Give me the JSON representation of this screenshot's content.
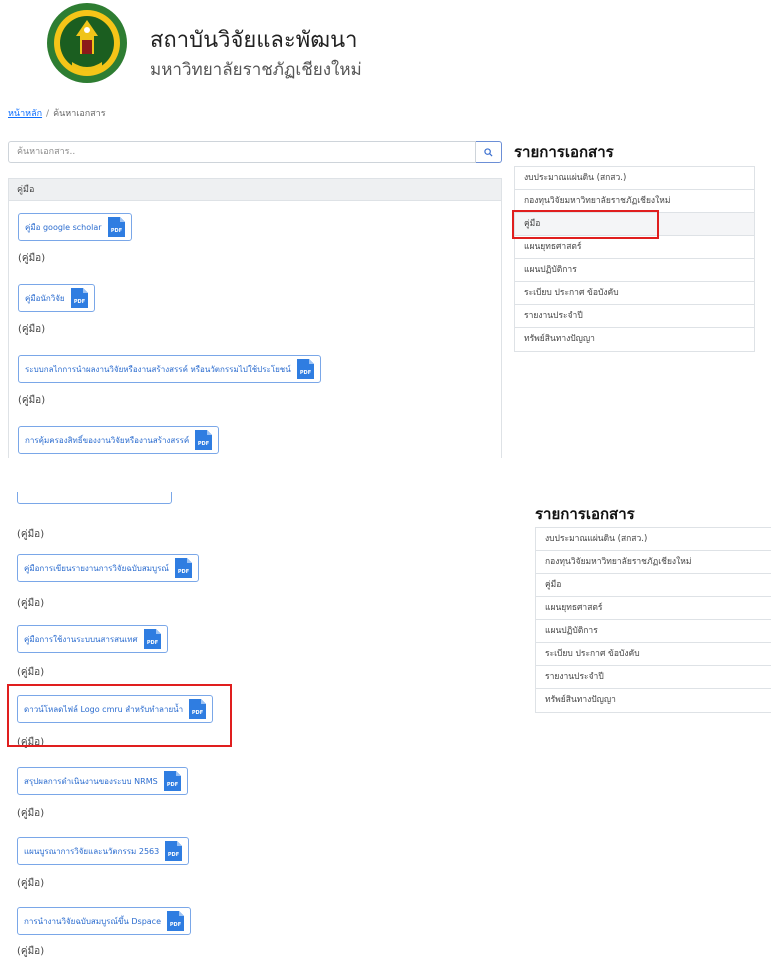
{
  "site": {
    "title": "สถาบันวิจัยและพัฒนา",
    "subtitle": "มหาวิทยาลัยราชภัฏเชียงใหม่",
    "logo_icon": "university-seal-logo"
  },
  "breadcrumb": {
    "home": "หน้าหลัก",
    "separator": "/",
    "current": "ค้นหาเอกสาร"
  },
  "search": {
    "placeholder": "ค้นหาเอกสาร..",
    "button_icon": "search-icon"
  },
  "category": {
    "header": "คู่มือ"
  },
  "pdf_icon": {
    "text": "PDF",
    "color": "#2f7de1"
  },
  "documents_top": [
    {
      "title": "คู่มือ google scholar",
      "category": "(คู่มือ)"
    },
    {
      "title": "คู่มือนักวิจัย",
      "category": "(คู่มือ)"
    },
    {
      "title": "ระบบกลไกการนำผลงานวิจัยหรืองานสร้างสรรค์ หรือนวัตกรรมไปใช้ประโยชน์",
      "category": "(คู่มือ)"
    },
    {
      "title": "การคุ้มครองสิทธิ์ของงานวิจัยหรืองานสร้างสรรค์",
      "category": ""
    }
  ],
  "documents_bottom": [
    {
      "title": "",
      "category": "(คู่มือ)"
    },
    {
      "title": "คู่มือการเขียนรายงานการวิจัยฉบับสมบูรณ์",
      "category": "(คู่มือ)"
    },
    {
      "title": "คู่มือการใช้งานระบบนสารสนเทศ",
      "category": "(คู่มือ)"
    },
    {
      "title": "ดาวน์โหลดไฟล์ Logo cmru สำหรับทำลายน้ำ",
      "category": "(คู่มือ)"
    },
    {
      "title": "สรุปผลการดำเนินงานของระบบ NRMS",
      "category": "(คู่มือ)"
    },
    {
      "title": "แผนบูรณาการวิจัยและนวัตกรรม 2563",
      "category": "(คู่มือ)"
    },
    {
      "title": "การนำงานวิจัยฉบับสมบูรณ์ขึ้น Dspace",
      "category": "(คู่มือ)"
    }
  ],
  "sidebar": {
    "title": "รายการเอกสาร",
    "items": [
      "งบประมาณแผ่นดิน (สกสว.)",
      "กองทุนวิจัยมหาวิทยาลัยราชภัฏเชียงใหม่",
      "คู่มือ",
      "แผนยุทธศาสตร์",
      "แผนปฏิบัติการ",
      "ระเบียบ ประกาศ ข้อบังคับ",
      "รายงานประจำปี",
      "ทรัพย์สินทางปัญญา"
    ],
    "active_index": 2
  },
  "highlight_color": "#e01e1e"
}
